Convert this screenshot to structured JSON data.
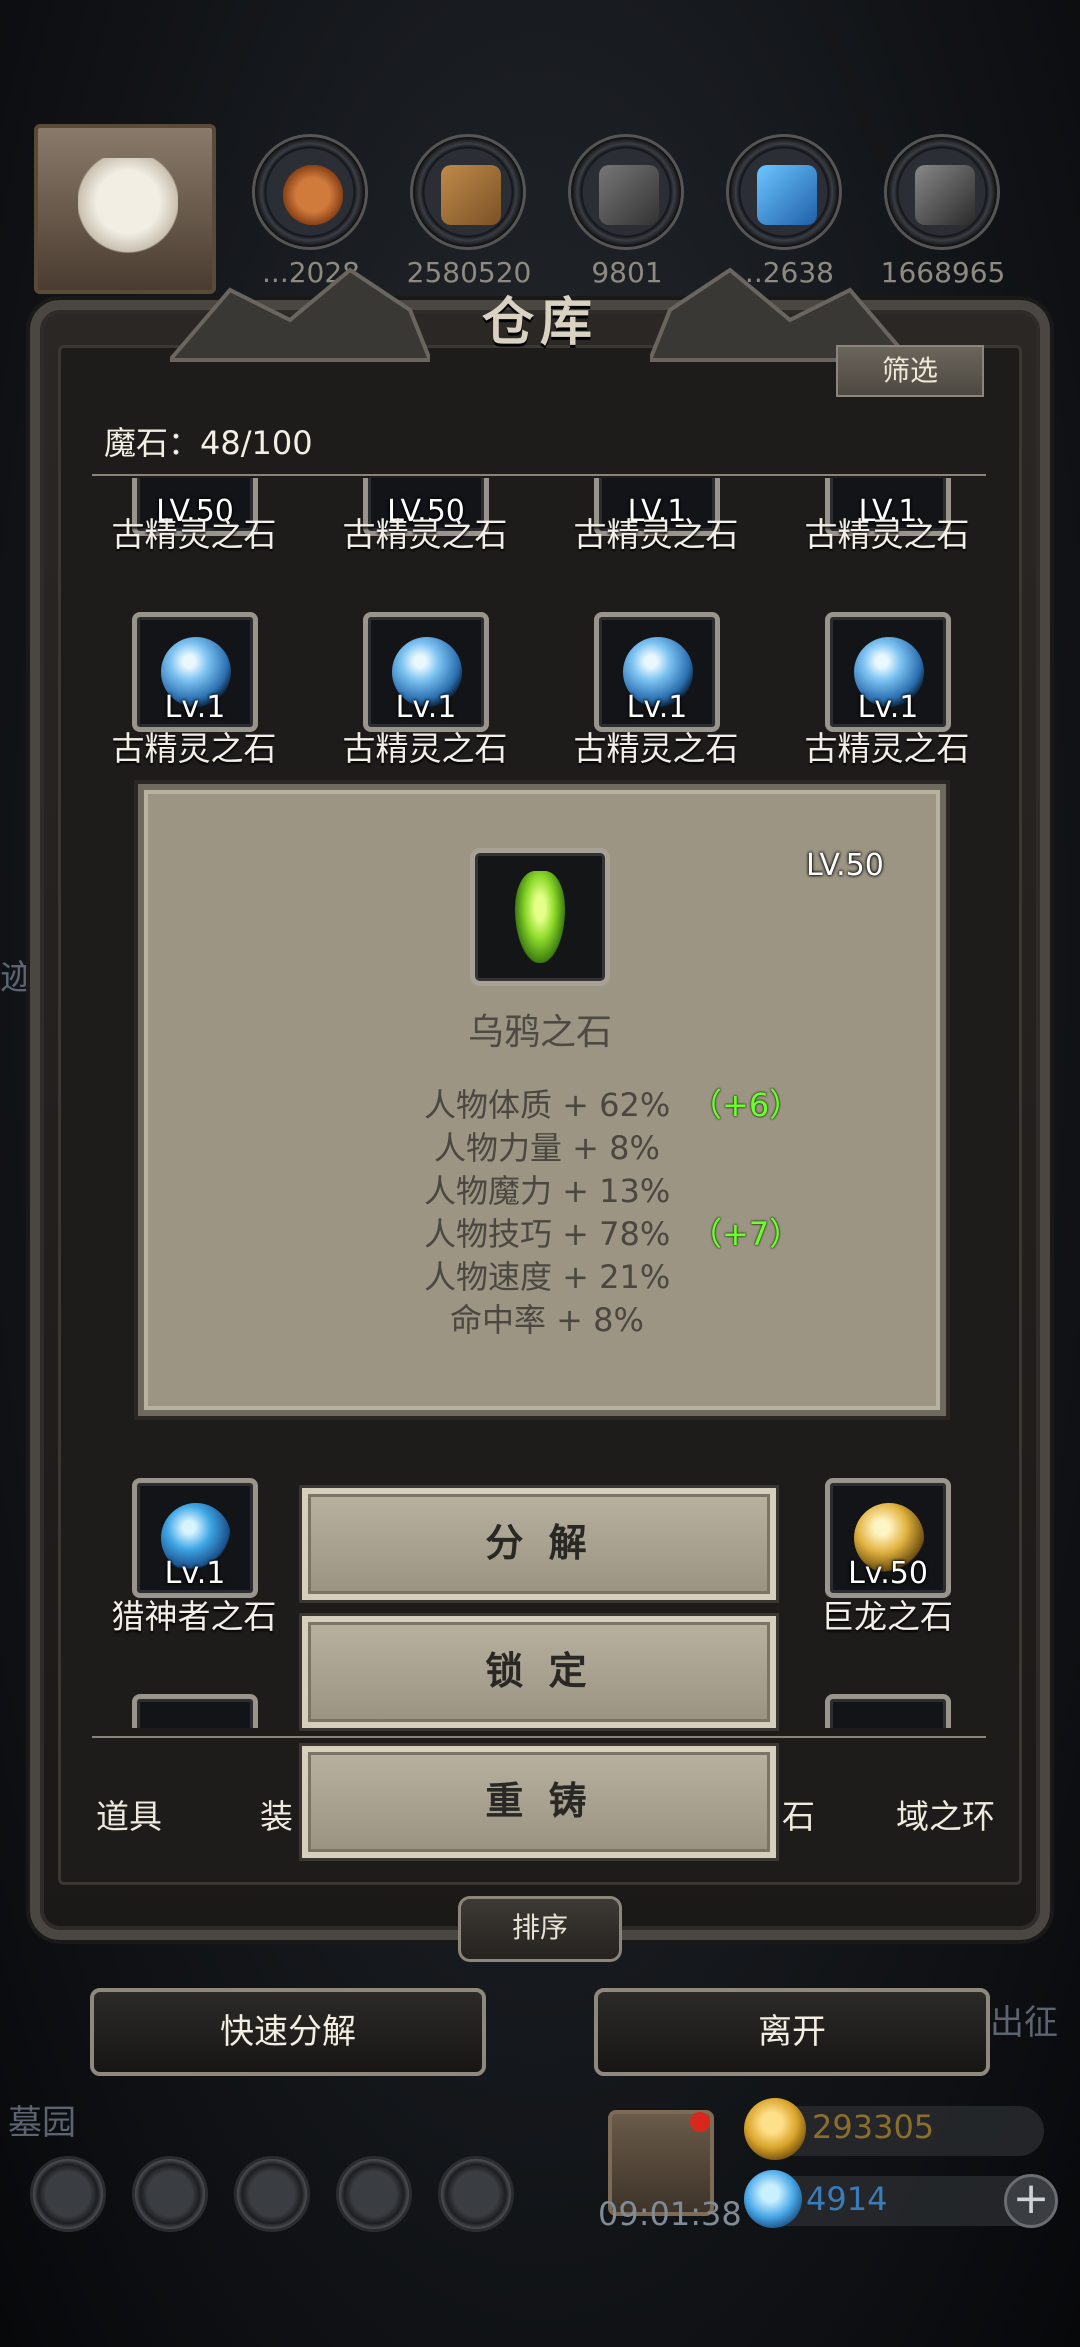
{
  "top_resources": {
    "values": [
      "...2028",
      "2580520",
      "9801",
      "...2638",
      "1668965"
    ]
  },
  "warehouse": {
    "title": "仓库",
    "filter_label": "筛选",
    "count_label": "魔石：48/100"
  },
  "items": {
    "row0": [
      {
        "lv": "LV.50",
        "name": "古精灵之石"
      },
      {
        "lv": "LV.50",
        "name": "古精灵之石"
      },
      {
        "lv": "LV.1",
        "name": "古精灵之石"
      },
      {
        "lv": "LV.1",
        "name": "古精灵之石"
      }
    ],
    "row1": [
      {
        "lv": "Lv.1",
        "name": "古精灵之石"
      },
      {
        "lv": "Lv.1",
        "name": "古精灵之石"
      },
      {
        "lv": "Lv.1",
        "name": "古精灵之石"
      },
      {
        "lv": "Lv.1",
        "name": "古精灵之石"
      }
    ],
    "row3": [
      {
        "lv": "Lv.1",
        "name": "猎神者之石"
      },
      {
        "lv": "Lv.50",
        "name": "巨龙之石"
      }
    ]
  },
  "tooltip": {
    "level": "LV.50",
    "name": "乌鸦之石",
    "stats": [
      {
        "text": "人物体质 + 62%",
        "bonus": "（+6）"
      },
      {
        "text": "人物力量 + 8%",
        "bonus": ""
      },
      {
        "text": "人物魔力 + 13%",
        "bonus": ""
      },
      {
        "text": "人物技巧 + 78%",
        "bonus": "（+7）"
      },
      {
        "text": "人物速度 + 21%",
        "bonus": ""
      },
      {
        "text": "命中率 + 8%",
        "bonus": ""
      }
    ]
  },
  "actions": {
    "decompose": "分 解",
    "lock": "锁 定",
    "recast": "重 铸"
  },
  "tabs": {
    "items": "道具",
    "equip_partial": "装",
    "stone_partial": "石",
    "domain_ring": "域之环"
  },
  "sort_label": "排序",
  "quick_decompose": "快速分解",
  "leave": "离开",
  "background_labels": {
    "left_partial": "迹",
    "right_partial": "出征",
    "graveyard": "墓园"
  },
  "hud": {
    "timer": "09:01:38",
    "gold": "293305",
    "diamond": "4914",
    "plus": "+"
  }
}
